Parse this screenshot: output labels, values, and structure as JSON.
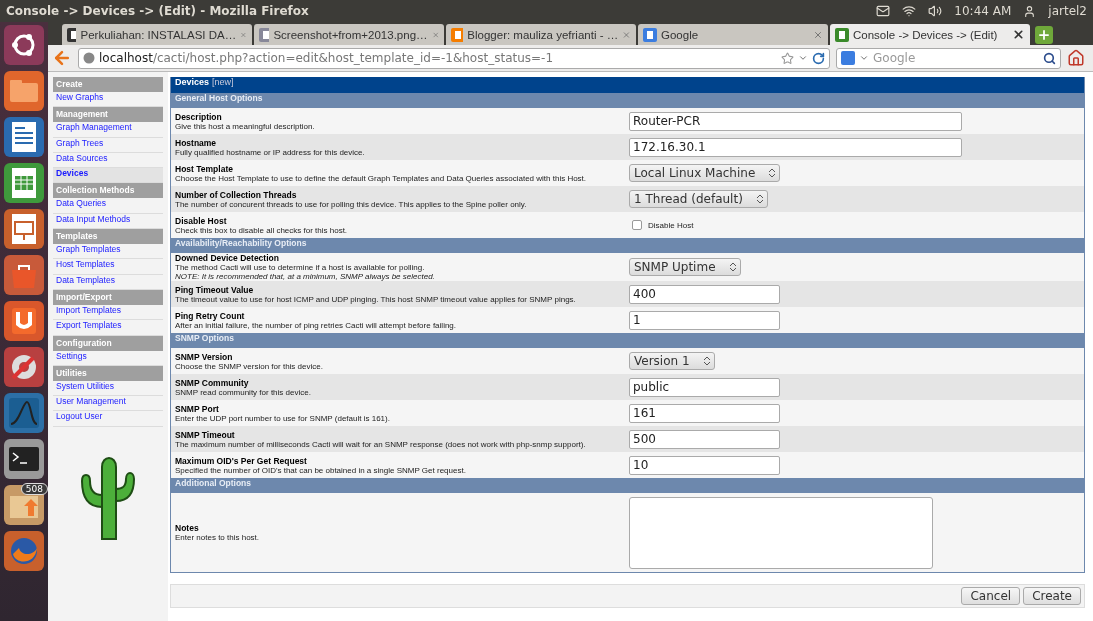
{
  "window": {
    "title": "Console -> Devices -> (Edit) - Mozilla Firefox"
  },
  "tray": {
    "time": "10:44 AM",
    "user": "jartel2"
  },
  "launcher": {
    "badge": "508"
  },
  "tabs": [
    {
      "label": "Perkuliahan: INSTALASI DA…",
      "selected": false
    },
    {
      "label": "Screenshot+from+2013.png…",
      "selected": false
    },
    {
      "label": "Blogger: mauliza yefrianti - …",
      "selected": false
    },
    {
      "label": "Google",
      "selected": false
    },
    {
      "label": "Console -> Devices -> (Edit)",
      "selected": true
    }
  ],
  "address_bar": {
    "url_host": "localhost",
    "url_path": "/cacti/host.php?action=edit&host_template_id=-1&host_status=-1",
    "search_placeholder": "Google"
  },
  "sidebar": {
    "items": [
      {
        "kind": "header",
        "label": "Create"
      },
      {
        "kind": "link",
        "label": "New Graphs",
        "selected": false
      },
      {
        "kind": "header",
        "label": "Management"
      },
      {
        "kind": "link",
        "label": "Graph Management",
        "selected": false
      },
      {
        "kind": "link",
        "label": "Graph Trees",
        "selected": false
      },
      {
        "kind": "link",
        "label": "Data Sources",
        "selected": false
      },
      {
        "kind": "link",
        "label": "Devices",
        "selected": true
      },
      {
        "kind": "header",
        "label": "Collection Methods"
      },
      {
        "kind": "link",
        "label": "Data Queries",
        "selected": false
      },
      {
        "kind": "link",
        "label": "Data Input Methods",
        "selected": false
      },
      {
        "kind": "header",
        "label": "Templates"
      },
      {
        "kind": "link",
        "label": "Graph Templates",
        "selected": false
      },
      {
        "kind": "link",
        "label": "Host Templates",
        "selected": false
      },
      {
        "kind": "link",
        "label": "Data Templates",
        "selected": false
      },
      {
        "kind": "header",
        "label": "Import/Export"
      },
      {
        "kind": "link",
        "label": "Import Templates",
        "selected": false
      },
      {
        "kind": "link",
        "label": "Export Templates",
        "selected": false
      },
      {
        "kind": "header",
        "label": "Configuration"
      },
      {
        "kind": "link",
        "label": "Settings",
        "selected": false
      },
      {
        "kind": "header",
        "label": "Utilities"
      },
      {
        "kind": "link",
        "label": "System Utilities",
        "selected": false
      },
      {
        "kind": "link",
        "label": "User Management",
        "selected": false
      },
      {
        "kind": "link",
        "label": "Logout User",
        "selected": false
      }
    ]
  },
  "form": {
    "title": "Devices",
    "title_suffix": "[new]",
    "sections": [
      {
        "title": "General Host Options",
        "rows": [
          {
            "label": "Description",
            "description": "Give this host a meaningful description.",
            "field": {
              "kind": "text",
              "value": "Router-PCR"
            }
          },
          {
            "label": "Hostname",
            "description": "Fully qualified hostname or IP address for this device.",
            "field": {
              "kind": "text",
              "value": "172.16.30.1"
            }
          },
          {
            "label": "Host Template",
            "description": "Choose the Host Template to use to define the default Graph Templates and Data Queries associated with this Host.",
            "field": {
              "kind": "select",
              "value": "Local Linux Machine"
            }
          },
          {
            "label": "Number of Collection Threads",
            "description": "The number of concurent threads to use for polling this device. This applies to the Spine poller only.",
            "field": {
              "kind": "select",
              "value": "1 Thread (default)"
            }
          },
          {
            "label": "Disable Host",
            "description": "Check this box to disable all checks for this host.",
            "field": {
              "kind": "checkbox",
              "checked": false,
              "label": "Disable Host"
            }
          }
        ]
      },
      {
        "title": "Availability/Reachability Options",
        "rows": [
          {
            "label": "Downed Device Detection",
            "description": "The method Cacti will use to determine if a host is available for polling.",
            "note": "NOTE: It is recommended that, at a minimum, SNMP always be selected.",
            "field": {
              "kind": "select",
              "value": "SNMP Uptime"
            }
          },
          {
            "label": "Ping Timeout Value",
            "description": "The timeout value to use for host ICMP and UDP pinging. This host SNMP timeout value applies for SNMP pings.",
            "field": {
              "kind": "text",
              "value": "400"
            }
          },
          {
            "label": "Ping Retry Count",
            "description": "After an initial failure, the number of ping retries Cacti will attempt before failing.",
            "field": {
              "kind": "text",
              "value": "1"
            }
          }
        ]
      },
      {
        "title": "SNMP Options",
        "rows": [
          {
            "label": "SNMP Version",
            "description": "Choose the SNMP version for this device.",
            "field": {
              "kind": "select",
              "value": "Version 1"
            }
          },
          {
            "label": "SNMP Community",
            "description": "SNMP read community for this device.",
            "field": {
              "kind": "text",
              "value": "public"
            }
          },
          {
            "label": "SNMP Port",
            "description": "Enter the UDP port number to use for SNMP (default is 161).",
            "field": {
              "kind": "text",
              "value": "161"
            }
          },
          {
            "label": "SNMP Timeout",
            "description": "The maximum number of milliseconds Cacti will wait for an SNMP response (does not work with php-snmp support).",
            "field": {
              "kind": "text",
              "value": "500"
            }
          },
          {
            "label": "Maximum OID's Per Get Request",
            "description": "Specified the number of OID's that can be obtained in a single SNMP Get request.",
            "field": {
              "kind": "text",
              "value": "10"
            }
          }
        ]
      },
      {
        "title": "Additional Options",
        "rows": [
          {
            "label": "Notes",
            "description": "Enter notes to this host.",
            "field": {
              "kind": "textarea"
            }
          }
        ]
      }
    ]
  },
  "buttons": [
    {
      "label": "Cancel"
    },
    {
      "label": "Create"
    }
  ]
}
